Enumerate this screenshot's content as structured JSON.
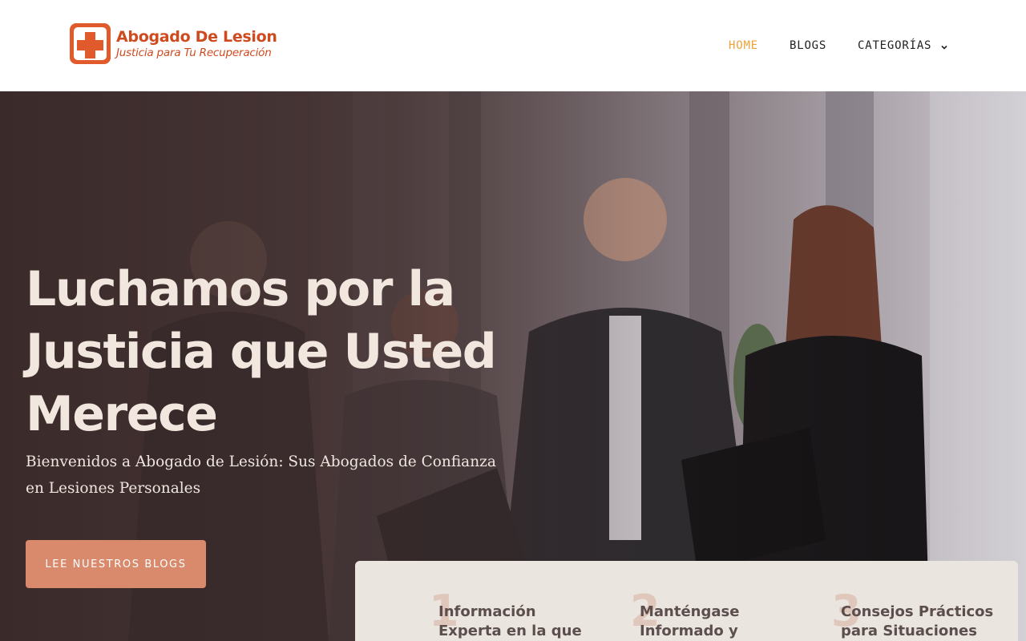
{
  "brand": {
    "name": "Abogado De Lesion",
    "tagline": "Justicia para Tu Recuperación",
    "color": "#cf4a1f"
  },
  "nav": {
    "home": "HOME",
    "blogs": "BLOGS",
    "categories": "CATEGORÍAS",
    "active_color": "#f0a23a"
  },
  "hero": {
    "title_line1": "Luchamos por la",
    "title_line2": "Justicia que Usted",
    "title_line3": "Merece",
    "subtitle": "Bienvenidos a Abogado de Lesión: Sus Abogados de Confianza en Lesiones Personales",
    "cta_label": "LEE NUESTROS BLOGS",
    "cta_color": "#d98a6c"
  },
  "features": [
    {
      "num": "1",
      "text": "Información Experta en la que Puede"
    },
    {
      "num": "2",
      "text": "Manténgase Informado y"
    },
    {
      "num": "3",
      "text": "Consejos Prácticos para Situaciones"
    }
  ]
}
